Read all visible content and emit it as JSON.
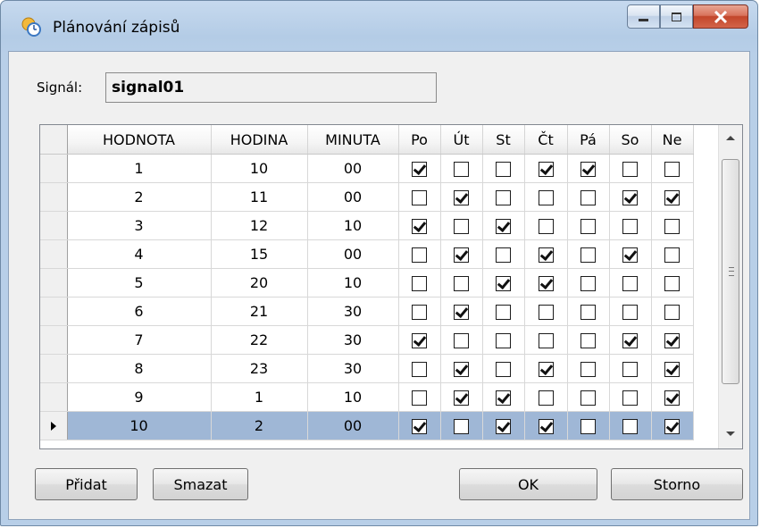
{
  "window": {
    "title": "Plánování zápisů"
  },
  "signal": {
    "label": "Signál:",
    "value": "signal01"
  },
  "grid": {
    "columns": [
      "HODNOTA",
      "HODINA",
      "MINUTA",
      "Po",
      "Út",
      "St",
      "Čt",
      "Pá",
      "So",
      "Ne"
    ],
    "rows": [
      {
        "hodnota": "1",
        "hodina": "10",
        "minuta": "00",
        "days": [
          true,
          false,
          false,
          true,
          true,
          false,
          false
        ]
      },
      {
        "hodnota": "2",
        "hodina": "11",
        "minuta": "00",
        "days": [
          false,
          true,
          false,
          false,
          false,
          true,
          true
        ]
      },
      {
        "hodnota": "3",
        "hodina": "12",
        "minuta": "10",
        "days": [
          true,
          false,
          true,
          false,
          false,
          false,
          false
        ]
      },
      {
        "hodnota": "4",
        "hodina": "15",
        "minuta": "00",
        "days": [
          false,
          true,
          false,
          true,
          false,
          true,
          false
        ]
      },
      {
        "hodnota": "5",
        "hodina": "20",
        "minuta": "10",
        "days": [
          false,
          false,
          true,
          true,
          false,
          false,
          false
        ]
      },
      {
        "hodnota": "6",
        "hodina": "21",
        "minuta": "30",
        "days": [
          false,
          true,
          false,
          false,
          false,
          false,
          false
        ]
      },
      {
        "hodnota": "7",
        "hodina": "22",
        "minuta": "30",
        "days": [
          true,
          false,
          false,
          false,
          false,
          true,
          true
        ]
      },
      {
        "hodnota": "8",
        "hodina": "23",
        "minuta": "30",
        "days": [
          false,
          true,
          false,
          true,
          false,
          false,
          true
        ]
      },
      {
        "hodnota": "9",
        "hodina": "1",
        "minuta": "10",
        "days": [
          false,
          true,
          true,
          false,
          false,
          false,
          true
        ]
      },
      {
        "hodnota": "10",
        "hodina": "2",
        "minuta": "00",
        "days": [
          true,
          false,
          true,
          true,
          false,
          false,
          true
        ],
        "selected": true
      }
    ]
  },
  "buttons": {
    "add": "Přidat",
    "delete": "Smazat",
    "ok": "OK",
    "cancel": "Storno"
  },
  "colors": {
    "selection": "#9fb7d6",
    "close_button": "#c2462b"
  },
  "icons": {
    "app": "calendar-clock-icon",
    "minimize": "minimize-icon",
    "maximize": "maximize-icon",
    "close": "close-icon"
  }
}
